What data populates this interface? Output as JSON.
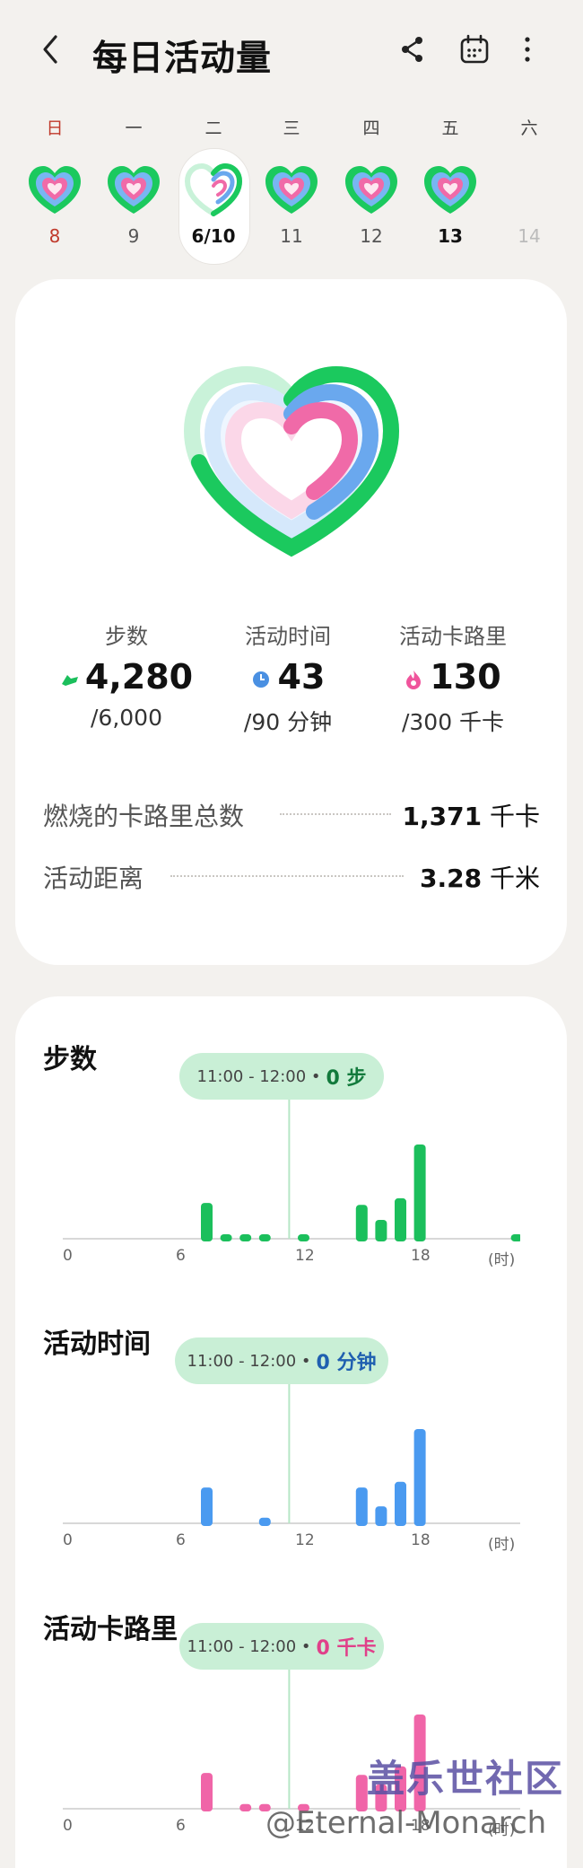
{
  "header": {
    "title": "每日活动量",
    "back_icon": "chevron-left-icon",
    "share_icon": "share-icon",
    "calendar_icon": "calendar-icon",
    "more_icon": "more-vertical-icon"
  },
  "week": {
    "weekdays": [
      "日",
      "一",
      "二",
      "三",
      "四",
      "五",
      "六"
    ],
    "dates": [
      "8",
      "9",
      "6/10",
      "11",
      "12",
      "13",
      "14"
    ],
    "selected_index": 2
  },
  "summary": {
    "steps": {
      "label": "步数",
      "value": "4,280",
      "goal": "/6,000",
      "icon": "shoe-icon",
      "color": "#1bbf5c"
    },
    "active_time": {
      "label": "活动时间",
      "value": "43",
      "goal": "/90 分钟",
      "icon": "clock-icon",
      "color": "#4a90e2"
    },
    "active_calories": {
      "label": "活动卡路里",
      "value": "130",
      "goal": "/300 千卡",
      "icon": "flame-icon",
      "color": "#f0549c"
    },
    "total_calories": {
      "label": "燃烧的卡路里总数",
      "value": "1,371",
      "unit": "千卡"
    },
    "distance": {
      "label": "活动距离",
      "value": "3.28",
      "unit": "千米"
    },
    "progress": {
      "steps": 0.713,
      "active_time": 0.478,
      "active_calories": 0.433
    }
  },
  "charts": {
    "steps": {
      "title": "步数",
      "tooltip_time": "11:00 - 12:00",
      "tooltip_value": "0 步",
      "tooltip_color": "#127a3c",
      "bar_color": "#1bbf5c"
    },
    "active_time": {
      "title": "活动时间",
      "tooltip_time": "11:00 - 12:00",
      "tooltip_value": "0 分钟",
      "tooltip_color": "#1f5fb0",
      "bar_color": "#4a9af0"
    },
    "active_calories": {
      "title": "活动卡路里",
      "tooltip_time": "11:00 - 12:00",
      "tooltip_value": "0 千卡",
      "tooltip_color": "#e0408a",
      "bar_color": "#f065a8"
    },
    "x_ticks": [
      "0",
      "6",
      "12",
      "18",
      "(时)"
    ]
  },
  "chart_data": [
    {
      "type": "bar",
      "title": "步数",
      "x": [
        0,
        1,
        2,
        3,
        4,
        5,
        6,
        7,
        8,
        9,
        10,
        11,
        12,
        13,
        14,
        15,
        16,
        17,
        18,
        19,
        20,
        21,
        22,
        23
      ],
      "values": [
        0,
        0,
        0,
        0,
        0,
        0,
        0,
        380,
        40,
        40,
        40,
        0,
        30,
        0,
        0,
        360,
        200,
        430,
        1000,
        0,
        0,
        0,
        0,
        40
      ],
      "ylim": [
        0,
        1000
      ]
    },
    {
      "type": "bar",
      "title": "活动时间",
      "x": [
        0,
        1,
        2,
        3,
        4,
        5,
        6,
        7,
        8,
        9,
        10,
        11,
        12,
        13,
        14,
        15,
        16,
        17,
        18,
        19,
        20,
        21,
        22,
        23
      ],
      "values": [
        0,
        0,
        0,
        0,
        0,
        0,
        0,
        3.8,
        0,
        0,
        0.6,
        0,
        0,
        0,
        0,
        3.8,
        1.8,
        4.4,
        10,
        0,
        0,
        0,
        0,
        0
      ],
      "ylim": [
        0,
        10
      ]
    },
    {
      "type": "bar",
      "title": "活动卡路里",
      "x": [
        0,
        1,
        2,
        3,
        4,
        5,
        6,
        7,
        8,
        9,
        10,
        11,
        12,
        13,
        14,
        15,
        16,
        17,
        18,
        19,
        20,
        21,
        22,
        23
      ],
      "values": [
        0,
        0,
        0,
        0,
        0,
        0,
        0,
        38,
        0,
        5,
        5,
        0,
        5,
        0,
        0,
        36,
        26,
        45,
        100,
        0,
        0,
        0,
        0,
        0
      ],
      "ylim": [
        0,
        100
      ]
    }
  ],
  "watermark": {
    "line1": "盖乐世社区",
    "line2": "@Eternal-Monarch"
  }
}
